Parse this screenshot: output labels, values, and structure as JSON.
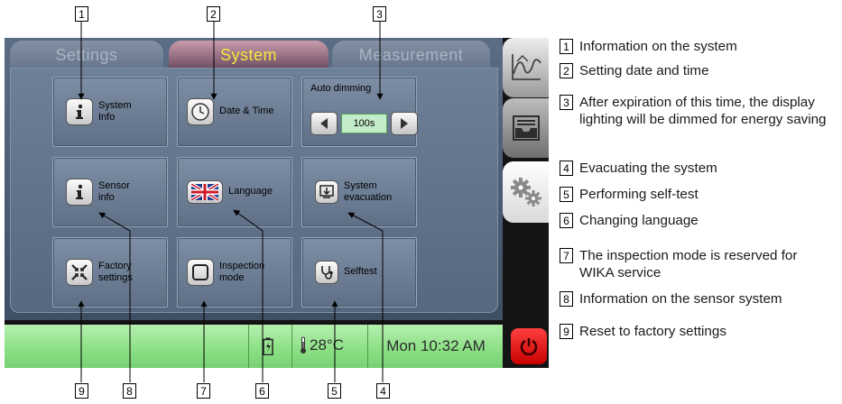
{
  "tabs": {
    "settings": "Settings",
    "system": "System",
    "measurement": "Measurement"
  },
  "tiles": {
    "system_info": "System Info",
    "date_time": "Date & Time",
    "auto_dimming_label": "Auto dimming",
    "auto_dimming_value": "100s",
    "sensor_info": "Sensor info",
    "language": "Language",
    "system_evacuation": "System evacuation",
    "factory_settings": "Factory settings",
    "inspection_mode": "Inspection mode",
    "selftest": "Selftest"
  },
  "icons": {
    "system_info": "info-icon",
    "date_time": "clock-icon",
    "sensor_info": "info-icon",
    "language": "uk-flag-icon",
    "system_evacuation": "evacuation-icon",
    "factory_settings": "factory-reset-icon",
    "inspection_mode": "square-icon",
    "selftest": "stethoscope-icon",
    "battery": "battery-charging-icon",
    "temperature": "thermometer-icon",
    "power": "power-icon",
    "rail": [
      "graph-icon",
      "data-tray-icon",
      "settings-gears-icon"
    ]
  },
  "status": {
    "temperature": "28°C",
    "clock": "Mon 10:32 AM"
  },
  "colors": {
    "active_tab_text": "#f5e83a",
    "status_bar": "#8adf83",
    "power_button": "#e00000",
    "value_field": "#c3ecc9"
  },
  "callouts": {
    "top": [
      "1",
      "2",
      "3"
    ],
    "bottom": [
      "9",
      "8",
      "7",
      "6",
      "5",
      "4"
    ]
  },
  "legend": [
    {
      "num": "1",
      "text": "Information on the system"
    },
    {
      "num": "2",
      "text": "Setting date and time"
    },
    {
      "num": "3",
      "text": "After expiration of this time, the display lighting will be dimmed for energy saving"
    },
    {
      "num": "4",
      "text": "Evacuating the system"
    },
    {
      "num": "5",
      "text": "Performing self-test"
    },
    {
      "num": "6",
      "text": "Changing language"
    },
    {
      "num": "7",
      "text": "The inspection mode is reserved for WIKA service"
    },
    {
      "num": "8",
      "text": "Information on the sensor system"
    },
    {
      "num": "9",
      "text": "Reset to factory settings"
    }
  ]
}
